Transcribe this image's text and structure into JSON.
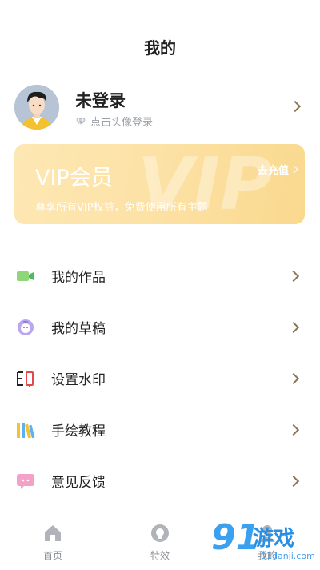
{
  "header": {
    "title": "我的"
  },
  "profile": {
    "name": "未登录",
    "hint": "点击头像登录"
  },
  "vip": {
    "title": "VIP会员",
    "description": "尊享所有VIP权益，免费使用所有主题",
    "action": "去充值",
    "background_text": "VIP"
  },
  "menu": [
    {
      "label": "我的作品",
      "icon": "video-camera-icon"
    },
    {
      "label": "我的草稿",
      "icon": "draft-face-icon"
    },
    {
      "label": "设置水印",
      "icon": "watermark-icon"
    },
    {
      "label": "手绘教程",
      "icon": "books-icon"
    },
    {
      "label": "意见反馈",
      "icon": "chat-bubble-icon"
    }
  ],
  "tabbar": [
    {
      "label": "首页",
      "icon": "home-icon"
    },
    {
      "label": "特效",
      "icon": "effects-icon"
    },
    {
      "label": "我的",
      "icon": "profile-icon"
    }
  ],
  "watermark": {
    "big": "91",
    "game": "游戏",
    "domain": "91danji.com"
  },
  "colors": {
    "accent_gold": "#8a7556",
    "vip_gradient_start": "#fde7b3",
    "vip_gradient_end": "#f9d98e"
  }
}
